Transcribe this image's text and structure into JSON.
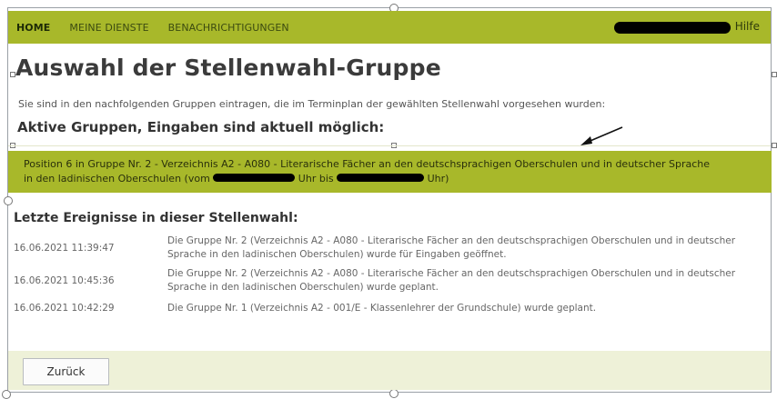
{
  "nav": {
    "items": [
      {
        "label": "HOME"
      },
      {
        "label": "MEINE DIENSTE"
      },
      {
        "label": "BENACHRICHTIGUNGEN"
      }
    ],
    "help": "Hilfe"
  },
  "page": {
    "title": "Auswahl der Stellenwahl-Gruppe",
    "intro": "Sie sind in den nachfolgenden Gruppen eintragen, die im Terminplan der gewählten Stellenwahl vorgesehen wurden:",
    "active_heading": "Aktive Gruppen, Eingaben sind aktuell möglich:"
  },
  "active_group": {
    "line1": "Position 6 in Gruppe Nr. 2 - Verzeichnis A2 - A080 - Literarische Fächer an den deutschsprachigen Oberschulen und in deutscher Sprache",
    "line2_a": "in den ladinischen Oberschulen (vom",
    "line2_b": "Uhr bis",
    "line2_c": "Uhr)"
  },
  "events": {
    "heading": "Letzte Ereignisse in dieser Stellenwahl:",
    "items": [
      {
        "timestamp": "16.06.2021 11:39:47",
        "text": "Die Gruppe Nr. 2 (Verzeichnis A2 - A080 - Literarische Fächer an den deutschsprachigen Oberschulen und in deutscher Sprache in den ladinischen Oberschulen) wurde für Eingaben geöffnet."
      },
      {
        "timestamp": "16.06.2021 10:45:36",
        "text": "Die Gruppe Nr. 2 (Verzeichnis A2 - A080 - Literarische Fächer an den deutschsprachigen Oberschulen und in deutscher Sprache in den ladinischen Oberschulen) wurde geplant."
      },
      {
        "timestamp": "16.06.2021 10:42:29",
        "text": "Die Gruppe Nr. 1 (Verzeichnis A2 - 001/E - Klassenlehrer der Grundschule) wurde geplant."
      }
    ]
  },
  "footer": {
    "back_label": "Zurück"
  },
  "colors": {
    "accent": "#a8b82a",
    "footer_bg": "#eef1d8"
  }
}
